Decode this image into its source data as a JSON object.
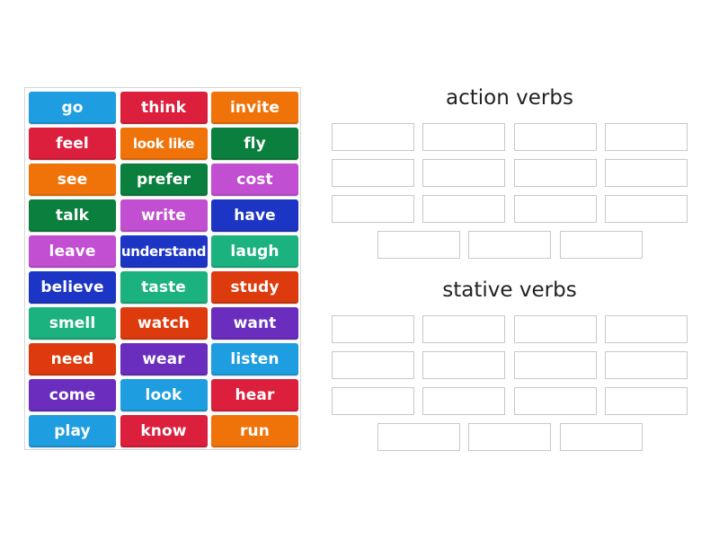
{
  "tray": {
    "tiles": [
      {
        "label": "go",
        "color": "#1e9ee0"
      },
      {
        "label": "think",
        "color": "#dc1f3d"
      },
      {
        "label": "invite",
        "color": "#f0730a"
      },
      {
        "label": "feel",
        "color": "#dc1f3d"
      },
      {
        "label": "look like",
        "color": "#f0730a"
      },
      {
        "label": "fly",
        "color": "#0b7f3d"
      },
      {
        "label": "see",
        "color": "#f0730a"
      },
      {
        "label": "prefer",
        "color": "#0b7f3d"
      },
      {
        "label": "cost",
        "color": "#c24fd1"
      },
      {
        "label": "talk",
        "color": "#0b7f3d"
      },
      {
        "label": "write",
        "color": "#c24fd1"
      },
      {
        "label": "have",
        "color": "#1c35c4"
      },
      {
        "label": "leave",
        "color": "#c24fd1"
      },
      {
        "label": "understand",
        "color": "#1c35c4"
      },
      {
        "label": "laugh",
        "color": "#1bb27f"
      },
      {
        "label": "believe",
        "color": "#1c35c4"
      },
      {
        "label": "taste",
        "color": "#1bb27f"
      },
      {
        "label": "study",
        "color": "#dd3a0d"
      },
      {
        "label": "smell",
        "color": "#1bb27f"
      },
      {
        "label": "watch",
        "color": "#dd3a0d"
      },
      {
        "label": "want",
        "color": "#6a2dbd"
      },
      {
        "label": "need",
        "color": "#dd3a0d"
      },
      {
        "label": "wear",
        "color": "#6a2dbd"
      },
      {
        "label": "listen",
        "color": "#1e9ee0"
      },
      {
        "label": "come",
        "color": "#6a2dbd"
      },
      {
        "label": "look",
        "color": "#1e9ee0"
      },
      {
        "label": "hear",
        "color": "#dc1f3d"
      },
      {
        "label": "play",
        "color": "#1e9ee0"
      },
      {
        "label": "know",
        "color": "#dc1f3d"
      },
      {
        "label": "run",
        "color": "#f0730a"
      }
    ]
  },
  "groups": [
    {
      "title": "action verbs",
      "slot_count": 15
    },
    {
      "title": "stative verbs",
      "slot_count": 15
    }
  ]
}
